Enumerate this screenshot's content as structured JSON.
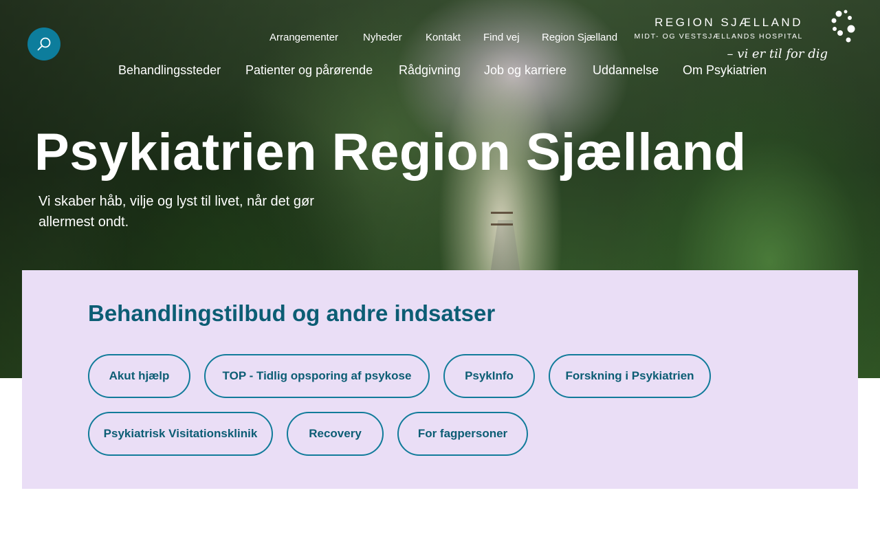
{
  "header": {
    "search_icon": "search-icon",
    "top_nav": [
      {
        "label": "Arrangementer"
      },
      {
        "label": "Nyheder"
      },
      {
        "label": "Kontakt"
      },
      {
        "label": "Find vej"
      },
      {
        "label": "Region Sjælland"
      }
    ],
    "main_nav": [
      {
        "label": "Behandlingssteder"
      },
      {
        "label": "Patienter og pårørende"
      },
      {
        "label": "Rådgivning"
      },
      {
        "label": "Job og karriere"
      },
      {
        "label": "Uddannelse"
      },
      {
        "label": "Om Psykiatrien"
      }
    ],
    "logo": {
      "wordmark": "REGION SJÆLLAND",
      "subtitle": "MIDT- OG VESTSJÆLLANDS HOSPITAL",
      "tagline": "– vi er til for dig"
    }
  },
  "hero": {
    "title": "Psykiatrien Region Sjælland",
    "lead": "Vi skaber håb, vilje og lyst til livet, når det gør allermest ondt."
  },
  "panel": {
    "title": "Behandlingstilbud og andre indsatser",
    "chips": [
      {
        "label": "Akut hjælp"
      },
      {
        "label": "TOP - Tidlig opsporing af psykose"
      },
      {
        "label": "PsykInfo"
      },
      {
        "label": "Forskning i Psykiatrien"
      },
      {
        "label": "Psykiatrisk Visitationsklinik"
      },
      {
        "label": "Recovery"
      },
      {
        "label": "For fagpersoner"
      }
    ]
  },
  "colors": {
    "accent": "#0d7d9c",
    "panel_background": "#eadef6",
    "heading_text": "#0c5d74"
  }
}
